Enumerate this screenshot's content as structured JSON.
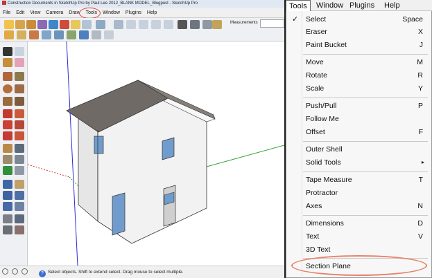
{
  "window": {
    "title": "Construction Documents in SketchUp Pro by Paul Lee 2012_BLANK MODEL_Blogpost - SketchUp Pro"
  },
  "menubar": {
    "items": [
      "File",
      "Edit",
      "View",
      "Camera",
      "Draw",
      "Tools",
      "Window",
      "Plugins",
      "Help"
    ]
  },
  "toolbar": {
    "measurements_label": "Measurements"
  },
  "status": {
    "text": "Select objects. Shift to extend select. Drag mouse to select multiple.",
    "help_glyph": "?"
  },
  "menu_header": {
    "items": [
      "Tools",
      "Window",
      "Plugins",
      "Help"
    ]
  },
  "tools_menu": {
    "items": [
      {
        "label": "Select",
        "shortcut": "Space",
        "checked": true,
        "check_glyph": "✓"
      },
      {
        "label": "Eraser",
        "shortcut": "X"
      },
      {
        "label": "Paint Bucket",
        "shortcut": "J"
      },
      {
        "label": "Move",
        "shortcut": "M"
      },
      {
        "label": "Rotate",
        "shortcut": "R"
      },
      {
        "label": "Scale",
        "shortcut": "Y"
      },
      {
        "label": "Push/Pull",
        "shortcut": "P"
      },
      {
        "label": "Follow Me",
        "shortcut": ""
      },
      {
        "label": "Offset",
        "shortcut": "F"
      },
      {
        "label": "Outer Shell",
        "shortcut": ""
      },
      {
        "label": "Solid Tools",
        "shortcut": "",
        "submenu": true,
        "arrow_glyph": "▸"
      },
      {
        "label": "Tape Measure",
        "shortcut": "T"
      },
      {
        "label": "Protractor",
        "shortcut": ""
      },
      {
        "label": "Axes",
        "shortcut": "N"
      },
      {
        "label": "Dimensions",
        "shortcut": "D"
      },
      {
        "label": "Text",
        "shortcut": "V"
      },
      {
        "label": "3D Text",
        "shortcut": ""
      },
      {
        "label": "Section Plane",
        "shortcut": ""
      }
    ]
  },
  "colors": {
    "annotation_ring": "#e03c3c",
    "section_ring": "#e8826b",
    "axis_blue": "#2b2bd6",
    "axis_green": "#2fa32f",
    "axis_red": "#cc3a3a",
    "wall": "#f2f2f2",
    "roof": "#6f6a66",
    "window_glass": "#6f9ccc"
  }
}
